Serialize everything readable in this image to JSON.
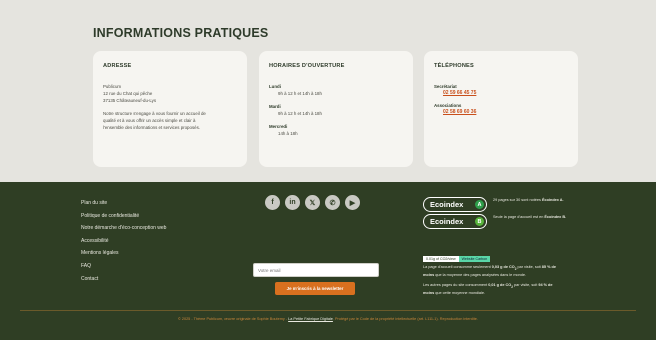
{
  "top": {
    "title": "INFORMATIONS PRATIQUES",
    "address": {
      "title": "ADRESSE",
      "lines": [
        "Publicum",
        "12 rue du Chat qui pêche",
        "37135 Châteauneuf-du-Lys"
      ],
      "description": [
        "Notre structure s'engage à vous fournir un accueil de",
        "qualité et à vous offrir un accès simple et clair à",
        "l'ensemble des informations et services proposés."
      ]
    },
    "hours": {
      "title": "HORAIRES D'OUVERTURE",
      "days": [
        {
          "day": "Lundi",
          "hours": "9h à 12 h et 14h à 18h"
        },
        {
          "day": "Mardi",
          "hours": "9h à 12 h et 14h à 18h"
        },
        {
          "day": "Mercredi",
          "hours": "14h à 18h"
        }
      ]
    },
    "phones": {
      "title": "TÉLÉPHONES",
      "entries": [
        {
          "label": "Secrétariat",
          "number": "02 59 66 45 75"
        },
        {
          "label": "Associations",
          "number": "02 58 69 60 36"
        }
      ]
    }
  },
  "footer": {
    "links": [
      "Plan du site",
      "Politique de confidentialité",
      "Notre démarche d'éco-conception web",
      "Accessibilité",
      "Mentions légales",
      "FAQ",
      "Contact"
    ],
    "socials": [
      {
        "icon": "facebook-icon",
        "glyph": "f"
      },
      {
        "icon": "linkedin-icon",
        "glyph": "in"
      },
      {
        "icon": "x-icon",
        "glyph": "𝕏"
      },
      {
        "icon": "whatsapp-icon",
        "glyph": "✆"
      },
      {
        "icon": "youtube-icon",
        "glyph": "▶"
      }
    ],
    "newsletter": {
      "placeholder": "Votre email",
      "button": "Je m'inscris à la newsletter"
    },
    "ecoindex": [
      {
        "label": "Ecoindex",
        "grade": "A",
        "color": "#2e9e4a",
        "note_text": "29 pages sur 30 sont notées ",
        "note_bold": "Écoindex A."
      },
      {
        "label": "Ecoindex",
        "grade": "B",
        "color": "#57b33b",
        "note_text": "Seule la page d'accueil est en ",
        "note_bold": "Écoindex B."
      }
    ],
    "website_carbon": {
      "badge_left": "0.01g of CO2/view",
      "badge_right": "Website Carbon",
      "p1": {
        "a": "La page d'accueil consomme seulement ",
        "b": "0,03 g de CO",
        "sub": "2",
        "c": " par visite, soit ",
        "d": "85 % de",
        "e": "moins",
        "f": " que la moyenne des pages analysées dans le monde."
      },
      "p2": {
        "a": "Les autres pages du site consomment ",
        "b": "0,01 g de CO",
        "sub": "2",
        "c": " par visite, soit ",
        "d": "94 % de",
        "e": "moins",
        "f": " que cette moyenne mondiale."
      }
    },
    "copyright": {
      "before": "© 2025 - Thème Publicum, œuvre originale de Sophie Boutemy - ",
      "link": "La Petite Fabrique Digitale",
      "after": ". Protégé par le Code de la propriété intellectuelle (art. L111-1). Reproduction interdite."
    }
  }
}
